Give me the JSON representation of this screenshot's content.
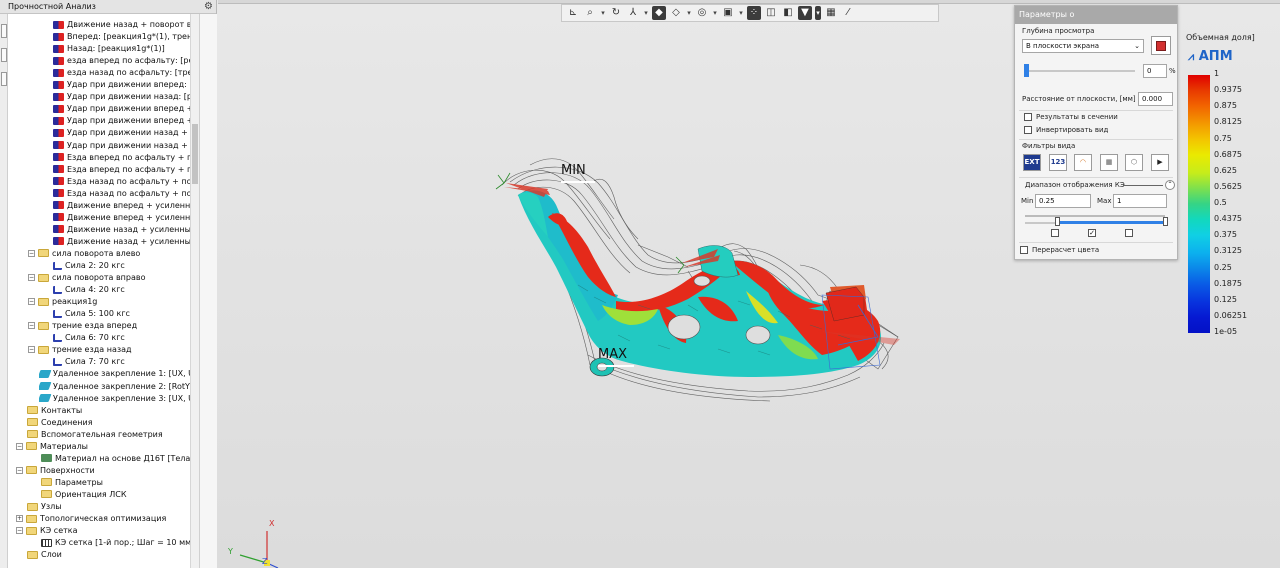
{
  "left_panel": {
    "title": "Прочностной Анализ",
    "tree": [
      {
        "label": "Движение назад + поворот вл",
        "indent": 4,
        "icon": "load-icon"
      },
      {
        "label": "Вперед: [реакция1g*(1), трени",
        "indent": 4,
        "icon": "load-icon"
      },
      {
        "label": "Назад: [реакция1g*(1)]",
        "indent": 4,
        "icon": "load-icon"
      },
      {
        "label": "езда вперед по асфальту: [реак",
        "indent": 4,
        "icon": "load-icon"
      },
      {
        "label": "езда назад по асфальту: [трени",
        "indent": 4,
        "icon": "load-icon"
      },
      {
        "label": "Удар при движении вперед: [т",
        "indent": 4,
        "icon": "load-icon"
      },
      {
        "label": "Удар при движении назад: [ре",
        "indent": 4,
        "icon": "load-icon"
      },
      {
        "label": "Удар при движении вперед +",
        "indent": 4,
        "icon": "load-icon"
      },
      {
        "label": "Удар при движении вперед +",
        "indent": 4,
        "icon": "load-icon"
      },
      {
        "label": "Удар при движении назад + по",
        "indent": 4,
        "icon": "load-icon"
      },
      {
        "label": "Удар при движении назад + по",
        "indent": 4,
        "icon": "load-icon"
      },
      {
        "label": "Езда вперед по асфальту + по",
        "indent": 4,
        "icon": "load-icon"
      },
      {
        "label": "Езда вперед по асфальту + по",
        "indent": 4,
        "icon": "load-icon"
      },
      {
        "label": "Езда назад по асфальту + пово",
        "indent": 4,
        "icon": "load-icon"
      },
      {
        "label": "Езда назад по асфальту + пово",
        "indent": 4,
        "icon": "load-icon"
      },
      {
        "label": "Движение вперед + усиленн",
        "indent": 4,
        "icon": "load-icon"
      },
      {
        "label": "Движение вперед + усиленн",
        "indent": 4,
        "icon": "load-icon"
      },
      {
        "label": "Движение назад + усиленный",
        "indent": 4,
        "icon": "load-icon"
      },
      {
        "label": "Движение назад + усиленный",
        "indent": 4,
        "icon": "load-icon"
      },
      {
        "label": "сила поворота влево",
        "indent": 3,
        "icon": "folder-icon",
        "exp": "−"
      },
      {
        "label": "Сила 2: 20 кгс",
        "indent": 4,
        "icon": "force-icon"
      },
      {
        "label": "сила поворота вправо",
        "indent": 3,
        "icon": "folder-icon",
        "exp": "−"
      },
      {
        "label": "Сила 4: 20 кгс",
        "indent": 4,
        "icon": "force-icon"
      },
      {
        "label": "реакция1g",
        "indent": 3,
        "icon": "folder-icon",
        "exp": "−"
      },
      {
        "label": "Сила 5: 100 кгс",
        "indent": 4,
        "icon": "force-icon"
      },
      {
        "label": "трение езда вперед",
        "indent": 3,
        "icon": "folder-icon",
        "exp": "−"
      },
      {
        "label": "Сила 6: 70 кгс",
        "indent": 4,
        "icon": "force-icon"
      },
      {
        "label": "трение езда назад",
        "indent": 3,
        "icon": "folder-icon",
        "exp": "−"
      },
      {
        "label": "Сила 7: 70 кгс",
        "indent": 4,
        "icon": "force-icon"
      },
      {
        "label": "Удаленное закрепление 1: [UX, U",
        "indent": 3,
        "icon": "fix-icon"
      },
      {
        "label": "Удаленное закрепление 2: [RotY]",
        "indent": 3,
        "icon": "fix-icon"
      },
      {
        "label": "Удаленное закрепление 3: [UX, U",
        "indent": 3,
        "icon": "fix-icon"
      },
      {
        "label": "Контакты",
        "indent": 1,
        "icon": "folder-icon"
      },
      {
        "label": "Соединения",
        "indent": 1,
        "icon": "folder-icon"
      },
      {
        "label": "Вспомогательная геометрия",
        "indent": 1,
        "icon": "folder-icon"
      },
      {
        "label": "Материалы",
        "indent": 1,
        "icon": "folder-icon",
        "exp": "−"
      },
      {
        "label": "Материал на основе Д16Т [Тела: ",
        "indent": 2,
        "icon": "material-icon"
      },
      {
        "label": "Поверхности",
        "indent": 1,
        "icon": "folder-icon",
        "exp": "−"
      },
      {
        "label": "Параметры",
        "indent": 2,
        "icon": "folder-icon"
      },
      {
        "label": "Ориентация ЛСК",
        "indent": 2,
        "icon": "folder-icon"
      },
      {
        "label": "Узлы",
        "indent": 1,
        "icon": "folder-icon"
      },
      {
        "label": "Топологическая оптимизация",
        "indent": 1,
        "icon": "folder-icon",
        "exp": "+"
      },
      {
        "label": "КЭ сетка",
        "indent": 1,
        "icon": "folder-icon",
        "exp": "−"
      },
      {
        "label": "КЭ сетка [1-й пор.; Шаг = 10 мм; К",
        "indent": 2,
        "icon": "mesh-icon"
      },
      {
        "label": "Слои",
        "indent": 1,
        "icon": "folder-icon"
      }
    ]
  },
  "viewport": {
    "min_label": "MIN",
    "max_label": "MAX",
    "axis_x": "X",
    "axis_y": "Y",
    "axis_z": "Z"
  },
  "params": {
    "title": "Параметры о",
    "depth_label": "Глубина просмотра",
    "depth_select": "В плоскости экрана",
    "slider_value": "0",
    "percent": "%",
    "distance_label": "Расстояние от плоскости, [мм]",
    "distance_value": "0.000",
    "results_in_section": "Результаты в сечении",
    "invert_view": "Инвертировать вид",
    "filters_label": "Фильтры вида",
    "filter_ext": "EXT",
    "filter_123": "123",
    "range_label": "Диапазон отображения КЭ",
    "min_label": "Min",
    "min_value": "0.25",
    "max_label": "Max",
    "max_value": "1",
    "recalc_color": "Перерасчет цвета"
  },
  "legend": {
    "title": "Объемная доля]",
    "logo": "АПМ",
    "values": [
      "1",
      "0.9375",
      "0.875",
      "0.8125",
      "0.75",
      "0.6875",
      "0.625",
      "0.5625",
      "0.5",
      "0.4375",
      "0.375",
      "0.3125",
      "0.25",
      "0.1875",
      "0.125",
      "0.06251",
      "1e-05"
    ]
  }
}
